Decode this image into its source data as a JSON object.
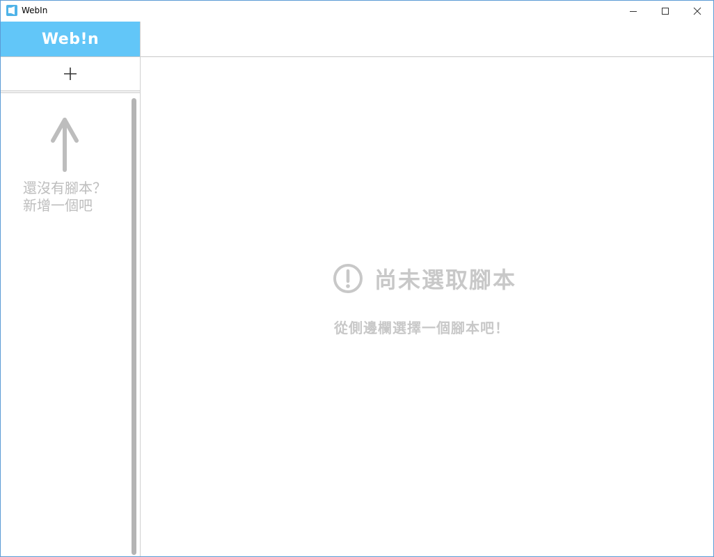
{
  "window": {
    "title": "WebIn",
    "icon": "webin-app-icon",
    "controls": [
      "minimize-icon",
      "maximize-icon",
      "close-icon"
    ]
  },
  "sidebar": {
    "brand": "Web!n",
    "add_button_icon": "plus-icon",
    "empty_hint": {
      "icon": "arrow-up-icon",
      "line1": "還沒有腳本？",
      "line2": "新增一個吧"
    }
  },
  "main": {
    "empty_state": {
      "icon": "exclamation-circle-icon",
      "title": "尚未選取腳本",
      "subtitle": "從側邊欄選擇一個腳本吧！"
    }
  },
  "colors": {
    "accent": "#62c6f8",
    "window_border": "#5b9bd5",
    "muted_text": "#c8c8c8"
  }
}
